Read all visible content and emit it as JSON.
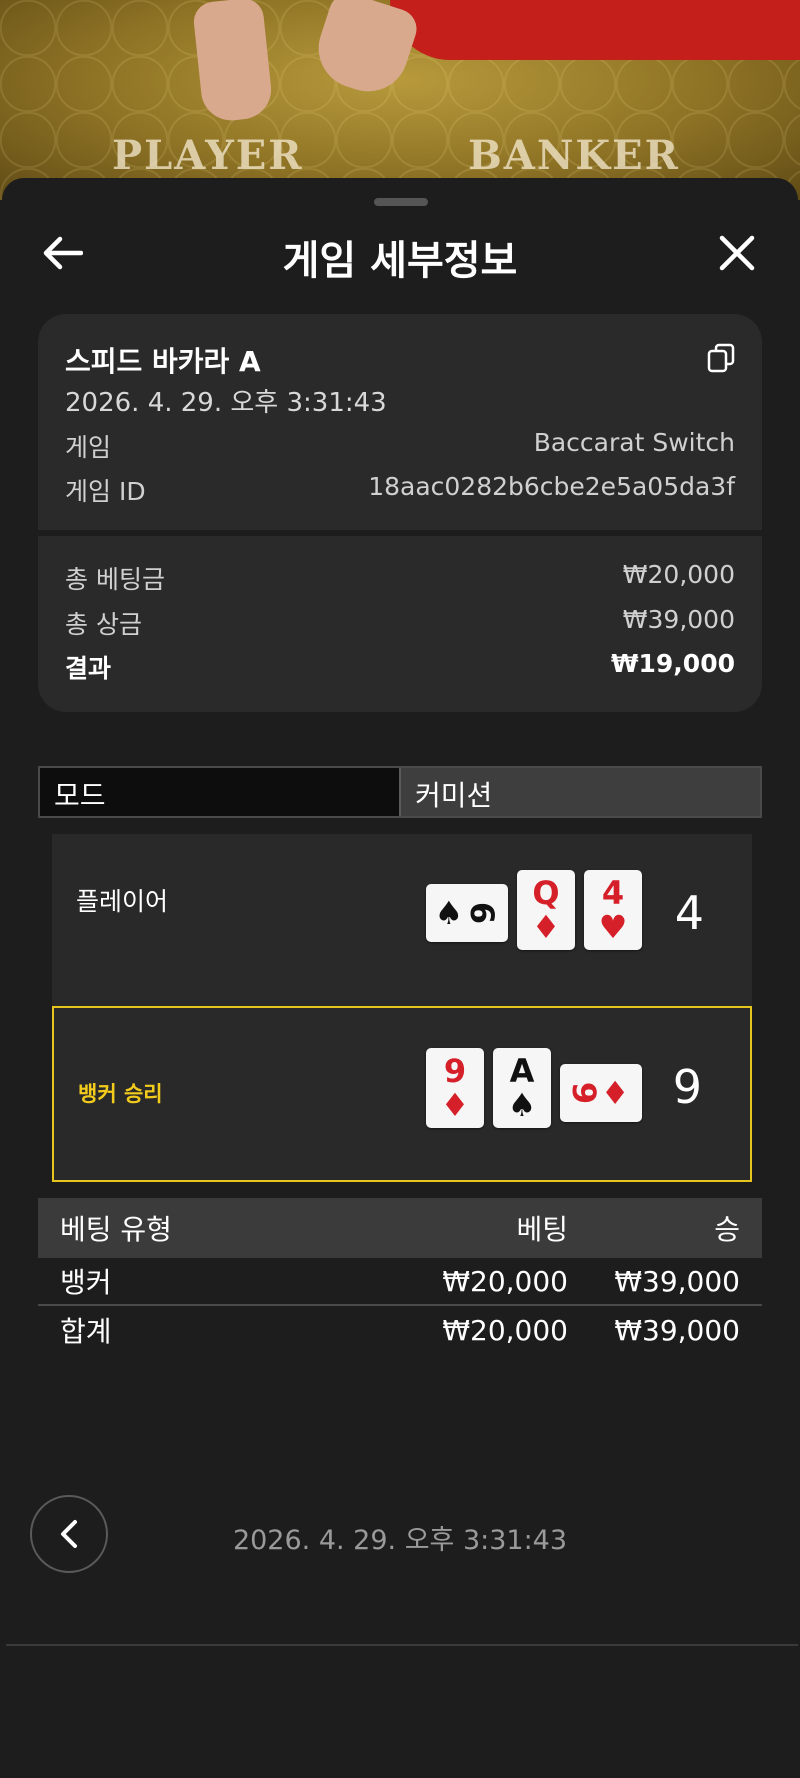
{
  "background": {
    "labels": {
      "player": "PLAYER",
      "banker": "BANKER"
    }
  },
  "header": {
    "title": "게임 세부정보",
    "back_icon": "arrow-left-icon",
    "close_icon": "close-icon"
  },
  "summary": {
    "game_name": "스피드 바카라 A",
    "datetime": "2026. 4. 29. 오후 3:31:43",
    "copy_icon": "copy-icon",
    "rows": [
      {
        "label": "게임",
        "value": "Baccarat Switch"
      },
      {
        "label": "게임 ID",
        "value": "18aac0282b6cbe2e5a05da3f"
      }
    ]
  },
  "totals": {
    "total_bet_label": "총 베팅금",
    "total_bet_value": "₩20,000",
    "total_win_label": "총 상금",
    "total_win_value": "₩39,000",
    "result_label": "결과",
    "result_value": "₩19,000"
  },
  "tabs": [
    {
      "label": "모드",
      "active": true
    },
    {
      "label": "커미션",
      "active": false
    }
  ],
  "hands": {
    "player": {
      "label": "플레이어",
      "score": "4",
      "cards": [
        {
          "rank": "6",
          "suit": "♠",
          "color": "black",
          "orientation": "horizontal"
        },
        {
          "rank": "Q",
          "suit": "♦",
          "color": "red",
          "orientation": "vertical"
        },
        {
          "rank": "4",
          "suit": "♥",
          "color": "red",
          "orientation": "vertical"
        }
      ]
    },
    "banker": {
      "label": "뱅커 승리",
      "score": "9",
      "cards": [
        {
          "rank": "9",
          "suit": "♦",
          "color": "red",
          "orientation": "vertical"
        },
        {
          "rank": "A",
          "suit": "♠",
          "color": "black",
          "orientation": "vertical"
        },
        {
          "rank": "9",
          "suit": "♦",
          "color": "red",
          "orientation": "horizontal"
        }
      ]
    },
    "win_color": "#f2cb1d"
  },
  "bets": {
    "headers": {
      "type": "베팅 유형",
      "bet": "베팅",
      "win": "승"
    },
    "rows": [
      {
        "type": "뱅커",
        "bet": "₩20,000",
        "win": "₩39,000"
      }
    ],
    "total": {
      "type": "합계",
      "bet": "₩20,000",
      "win": "₩39,000"
    }
  },
  "footer": {
    "back_icon": "chevron-left-icon",
    "datetime": "2026. 4. 29. 오후 3:31:43"
  }
}
